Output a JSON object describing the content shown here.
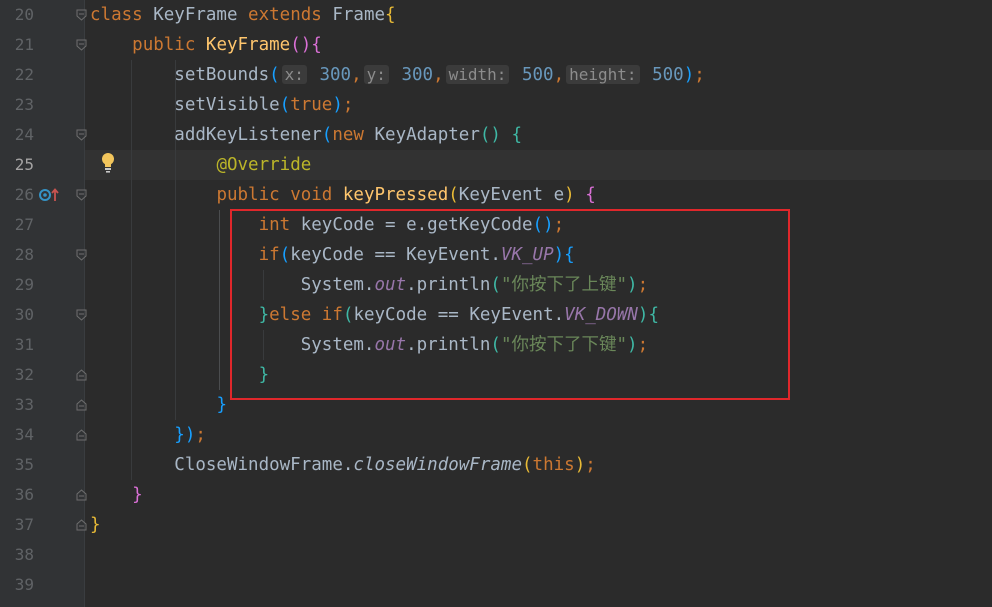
{
  "editor": {
    "current_line": "25",
    "lines": [
      {
        "n": "20",
        "tokens": [
          [
            "kw",
            "class "
          ],
          [
            "",
            "KeyFrame "
          ],
          [
            "kw",
            "extends "
          ],
          [
            "",
            "Frame"
          ],
          [
            "b1",
            "{"
          ]
        ]
      },
      {
        "n": "21",
        "tokens": [
          [
            "",
            "    "
          ],
          [
            "kw",
            "public "
          ],
          [
            "fn",
            "KeyFrame"
          ],
          [
            "b2",
            "()"
          ],
          [
            "b2",
            "{"
          ]
        ]
      },
      {
        "n": "22",
        "tokens": [
          [
            "",
            "        setBounds"
          ],
          [
            "b3",
            "("
          ],
          [
            "hint",
            "x:"
          ],
          [
            "num",
            " 300"
          ],
          [
            "kw",
            ","
          ],
          [
            "hint",
            "y:"
          ],
          [
            "num",
            " 300"
          ],
          [
            "kw",
            ","
          ],
          [
            "hint",
            "width:"
          ],
          [
            "num",
            " 500"
          ],
          [
            "kw",
            ","
          ],
          [
            "hint",
            "height:"
          ],
          [
            "num",
            " 500"
          ],
          [
            "b3",
            ")"
          ],
          [
            "kw",
            ";"
          ]
        ]
      },
      {
        "n": "23",
        "tokens": [
          [
            "",
            "        setVisible"
          ],
          [
            "b3",
            "("
          ],
          [
            "kw",
            "true"
          ],
          [
            "b3",
            ")"
          ],
          [
            "kw",
            ";"
          ]
        ]
      },
      {
        "n": "24",
        "tokens": [
          [
            "",
            "        addKeyListener"
          ],
          [
            "b3",
            "("
          ],
          [
            "kw",
            "new "
          ],
          [
            "",
            "KeyAdapter"
          ],
          [
            "b4",
            "()"
          ],
          [
            "",
            ""
          ],
          [
            "b4",
            " {"
          ]
        ]
      },
      {
        "n": "25",
        "tokens": [
          [
            "",
            "            "
          ],
          [
            "ann",
            "@Override"
          ]
        ]
      },
      {
        "n": "26",
        "tokens": [
          [
            "",
            "            "
          ],
          [
            "kw",
            "public void "
          ],
          [
            "fn",
            "keyPressed"
          ],
          [
            "b1",
            "("
          ],
          [
            "",
            "KeyEvent e"
          ],
          [
            "b1",
            ")"
          ],
          [
            "b2",
            " {"
          ]
        ]
      },
      {
        "n": "27",
        "tokens": [
          [
            "",
            "                "
          ],
          [
            "kw",
            "int "
          ],
          [
            "",
            "keyCode = e.getKeyCode"
          ],
          [
            "b3",
            "()"
          ],
          [
            "kw",
            ";"
          ]
        ]
      },
      {
        "n": "28",
        "tokens": [
          [
            "",
            "                "
          ],
          [
            "kw",
            "if"
          ],
          [
            "b3",
            "("
          ],
          [
            "",
            "keyCode == KeyEvent."
          ],
          [
            "static",
            "VK_UP"
          ],
          [
            "b3",
            ")"
          ],
          [
            "b3",
            "{"
          ]
        ]
      },
      {
        "n": "29",
        "tokens": [
          [
            "",
            "                    System."
          ],
          [
            "static",
            "out"
          ],
          [
            "",
            ".println"
          ],
          [
            "b4",
            "("
          ],
          [
            "str",
            "\"你按下了上键\""
          ],
          [
            "b4",
            ")"
          ],
          [
            "kw",
            ";"
          ]
        ]
      },
      {
        "n": "30",
        "tokens": [
          [
            "",
            "                "
          ],
          [
            "b4",
            "}"
          ],
          [
            "kw",
            "else if"
          ],
          [
            "b4",
            "("
          ],
          [
            "",
            "keyCode == KeyEvent."
          ],
          [
            "static",
            "VK_DOWN"
          ],
          [
            "b4",
            ")"
          ],
          [
            "b4",
            "{"
          ]
        ]
      },
      {
        "n": "31",
        "tokens": [
          [
            "",
            "                    System."
          ],
          [
            "static",
            "out"
          ],
          [
            "",
            ".println"
          ],
          [
            "b4",
            "("
          ],
          [
            "str",
            "\"你按下了下键\""
          ],
          [
            "b4",
            ")"
          ],
          [
            "kw",
            ";"
          ]
        ]
      },
      {
        "n": "32",
        "tokens": [
          [
            "",
            "                "
          ],
          [
            "b4",
            "}"
          ]
        ]
      },
      {
        "n": "33",
        "tokens": [
          [
            "",
            "            "
          ],
          [
            "b3",
            "}"
          ]
        ]
      },
      {
        "n": "34",
        "tokens": [
          [
            "",
            "        "
          ],
          [
            "b3",
            "}"
          ],
          [
            "b3",
            ")"
          ],
          [
            "kw",
            ";"
          ]
        ]
      },
      {
        "n": "35",
        "tokens": [
          [
            "",
            "        CloseWindowFrame."
          ],
          [
            "ital",
            "closeWindowFrame"
          ],
          [
            "b1",
            "("
          ],
          [
            "kw",
            "this"
          ],
          [
            "b1",
            ")"
          ],
          [
            "kw",
            ";"
          ]
        ]
      },
      {
        "n": "36",
        "tokens": [
          [
            "",
            "    "
          ],
          [
            "b2",
            "}"
          ]
        ]
      },
      {
        "n": "37",
        "tokens": [
          [
            "b1",
            "}"
          ]
        ]
      },
      {
        "n": "38",
        "tokens": []
      },
      {
        "n": "39",
        "tokens": []
      }
    ]
  },
  "icons": {
    "bulb": "lightbulb-icon",
    "override": "override-method-icon",
    "fold": "fold-marker-icon"
  },
  "colors": {
    "highlight_box": "#e0272b",
    "keyword": "#cc7832",
    "function": "#ffc66d",
    "number": "#6897bb",
    "string": "#6a8759",
    "annotation": "#bbb529"
  }
}
